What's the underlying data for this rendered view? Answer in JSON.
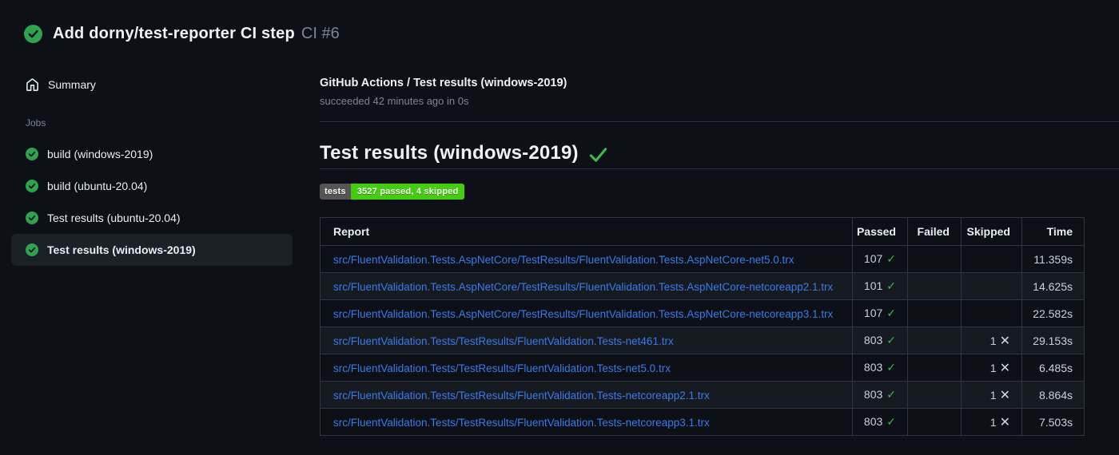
{
  "header": {
    "title": "Add dorny/test-reporter CI step",
    "run_label": "CI #6"
  },
  "sidebar": {
    "summary_label": "Summary",
    "jobs_heading": "Jobs",
    "jobs": [
      {
        "label": "build (windows-2019)",
        "status": "success",
        "selected": false
      },
      {
        "label": "build (ubuntu-20.04)",
        "status": "success",
        "selected": false
      },
      {
        "label": "Test results (ubuntu-20.04)",
        "status": "success",
        "selected": false
      },
      {
        "label": "Test results (windows-2019)",
        "status": "success",
        "selected": true
      }
    ]
  },
  "main": {
    "job_title": "GitHub Actions / Test results (windows-2019)",
    "job_status": "succeeded 42 minutes ago in 0s",
    "section_title": "Test results (windows-2019)",
    "badge": {
      "label": "tests",
      "value": "3527 passed, 4 skipped"
    },
    "table": {
      "columns": {
        "report": "Report",
        "passed": "Passed",
        "failed": "Failed",
        "skipped": "Skipped",
        "time": "Time"
      },
      "rows": [
        {
          "report": "src/FluentValidation.Tests.AspNetCore/TestResults/FluentValidation.Tests.AspNetCore-net5.0.trx",
          "passed": "107",
          "failed": "",
          "skipped": "",
          "time": "11.359s"
        },
        {
          "report": "src/FluentValidation.Tests.AspNetCore/TestResults/FluentValidation.Tests.AspNetCore-netcoreapp2.1.trx",
          "passed": "101",
          "failed": "",
          "skipped": "",
          "time": "14.625s"
        },
        {
          "report": "src/FluentValidation.Tests.AspNetCore/TestResults/FluentValidation.Tests.AspNetCore-netcoreapp3.1.trx",
          "passed": "107",
          "failed": "",
          "skipped": "",
          "time": "22.582s"
        },
        {
          "report": "src/FluentValidation.Tests/TestResults/FluentValidation.Tests-net461.trx",
          "passed": "803",
          "failed": "",
          "skipped": "1",
          "time": "29.153s"
        },
        {
          "report": "src/FluentValidation.Tests/TestResults/FluentValidation.Tests-net5.0.trx",
          "passed": "803",
          "failed": "",
          "skipped": "1",
          "time": "6.485s"
        },
        {
          "report": "src/FluentValidation.Tests/TestResults/FluentValidation.Tests-netcoreapp2.1.trx",
          "passed": "803",
          "failed": "",
          "skipped": "1",
          "time": "8.864s"
        },
        {
          "report": "src/FluentValidation.Tests/TestResults/FluentValidation.Tests-netcoreapp3.1.trx",
          "passed": "803",
          "failed": "",
          "skipped": "1",
          "time": "7.503s"
        }
      ]
    }
  },
  "icons": {
    "status_icon": "check-circle",
    "summary_icon": "home",
    "passed_icon": "check",
    "skipped_icon": "x"
  },
  "colors": {
    "page_bg": "#0d1117",
    "success_circle": "#2ea44f",
    "check_green": "#3fb950",
    "link_blue": "#3a7ae8",
    "badge_label_bg": "#555555",
    "badge_value_bg": "#44cc11",
    "selected_item_bg": "#1c2128",
    "table_border": "#30363d",
    "row_alt_bg": "#161b22"
  }
}
